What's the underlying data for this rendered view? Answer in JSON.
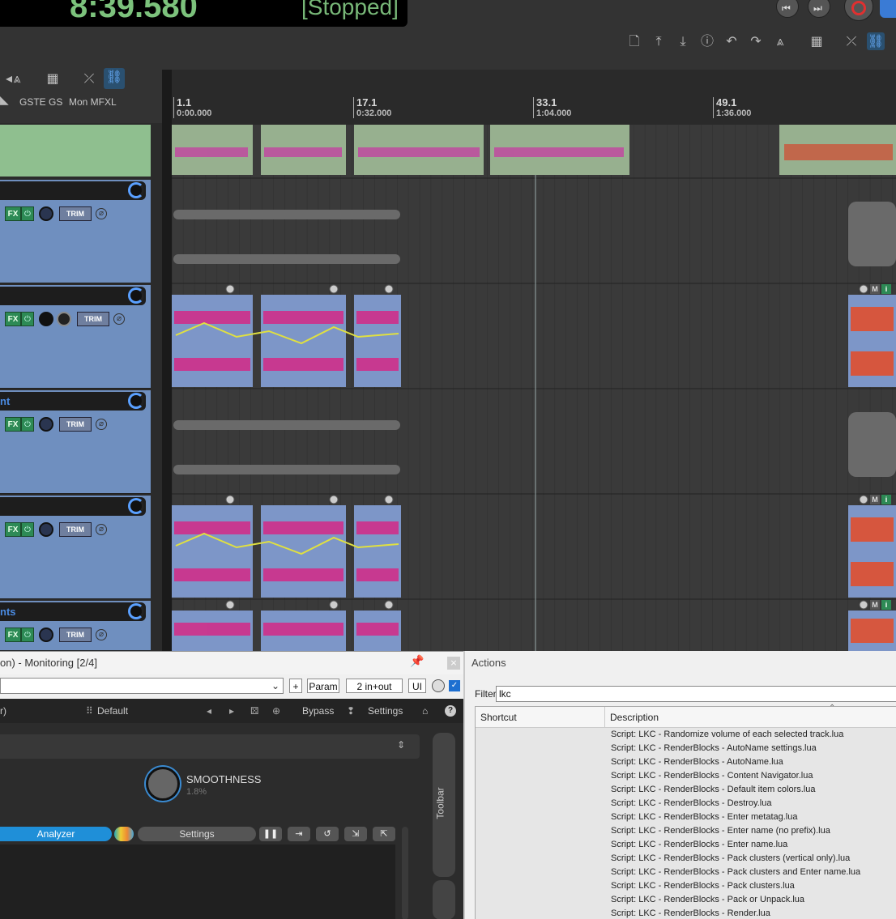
{
  "transport": {
    "time": "8:39.580",
    "state": "[Stopped]"
  },
  "tcp_toolbar": {
    "labels": [
      "GSTE",
      "GS",
      "Mon MFXL"
    ]
  },
  "ruler": {
    "marks": [
      {
        "bar": "1.1",
        "time": "0:00.000"
      },
      {
        "bar": "17.1",
        "time": "0:32.000"
      },
      {
        "bar": "33.1",
        "time": "1:04.000"
      },
      {
        "bar": "49.1",
        "time": "1:36.000"
      }
    ]
  },
  "tracks": [
    {
      "name": "",
      "fx": "FX",
      "trim": "TRIM"
    },
    {
      "name": "",
      "fx": "FX",
      "trim": "TRIM"
    },
    {
      "name": "nt",
      "fx": "FX",
      "trim": "TRIM"
    },
    {
      "name": "",
      "fx": "FX",
      "trim": "TRIM"
    },
    {
      "name": "nts",
      "fx": "FX",
      "trim": "TRIM"
    }
  ],
  "item_buttons": {
    "m": "M",
    "i": "i"
  },
  "fx_window": {
    "title": "on) - Monitoring [2/4]",
    "plus": "+",
    "param": "Param",
    "io": "2 in+out",
    "ui": "UI",
    "preset_left": "r)",
    "preset": "Default",
    "bypass": "Bypass",
    "settings": "Settings",
    "smoothness_label": "SMOOTHNESS",
    "smoothness_value": "1.8%",
    "analyzer": "Analyzer",
    "settings2": "Settings",
    "toolbar": "Toolbar"
  },
  "actions": {
    "title": "Actions",
    "filter_label": "Filter:",
    "filter_value": "lkc",
    "col_shortcut": "Shortcut",
    "col_description": "Description",
    "rows": [
      "Script: LKC - Randomize volume of each selected track.lua",
      "Script: LKC - RenderBlocks - AutoName settings.lua",
      "Script: LKC - RenderBlocks - AutoName.lua",
      "Script: LKC - RenderBlocks - Content Navigator.lua",
      "Script: LKC - RenderBlocks - Default item colors.lua",
      "Script: LKC - RenderBlocks - Destroy.lua",
      "Script: LKC - RenderBlocks - Enter metatag.lua",
      "Script: LKC - RenderBlocks - Enter name (no prefix).lua",
      "Script: LKC - RenderBlocks - Enter name.lua",
      "Script: LKC - RenderBlocks - Pack clusters (vertical only).lua",
      "Script: LKC - RenderBlocks - Pack clusters and Enter name.lua",
      "Script: LKC - RenderBlocks - Pack clusters.lua",
      "Script: LKC - RenderBlocks - Pack or Unpack.lua",
      "Script: LKC - RenderBlocks - Render.lua"
    ]
  }
}
